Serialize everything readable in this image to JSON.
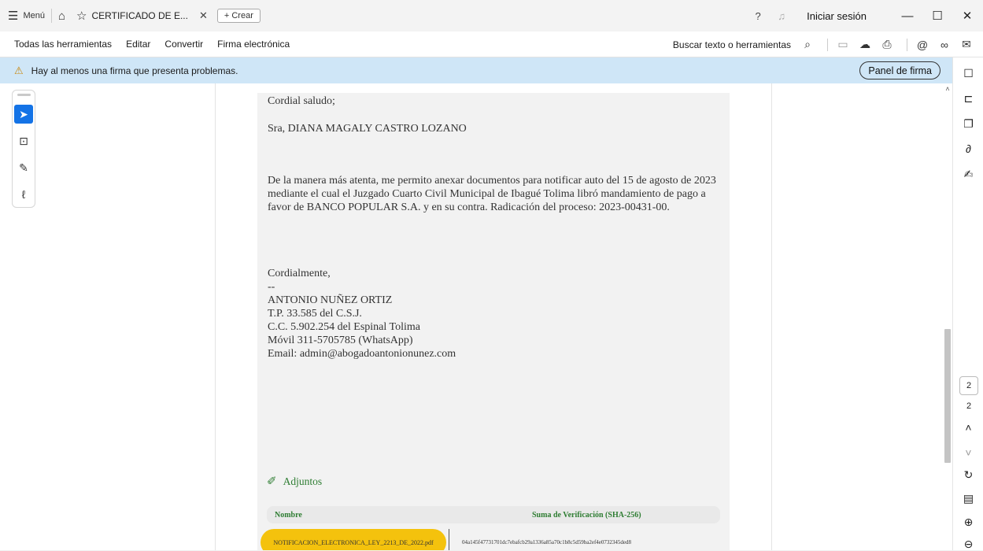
{
  "titlebar": {
    "menu_label": "Menú",
    "tab_title": "CERTIFICADO DE E...",
    "create_label": "+ Crear",
    "signin_label": "Iniciar sesión"
  },
  "toolbar": {
    "items": [
      "Todas las herramientas",
      "Editar",
      "Convertir",
      "Firma electrónica"
    ],
    "search_label": "Buscar texto o herramientas"
  },
  "banner": {
    "message": "Hay al menos una firma que presenta problemas.",
    "panel_button": "Panel de firma"
  },
  "document": {
    "greeting": "Cordial saludo;",
    "recipient": "Sra, DIANA MAGALY CASTRO LOZANO",
    "body": "De la manera más atenta, me permito anexar documentos para notificar auto del 15 de agosto de 2023 mediante el cual el Juzgado Cuarto Civil Municipal de Ibagué Tolima libró mandamiento de pago a favor de BANCO POPULAR S.A. y en su contra. Radicación del proceso: 2023-00431-00.",
    "closing": "Cordialmente,",
    "dashes": "--",
    "signature": [
      "ANTONIO  NUÑEZ ORTIZ",
      "T.P. 33.585 del C.S.J.",
      "C.C. 5.902.254 del Espinal Tolima",
      "Móvil 311-5705785 (WhatsApp)",
      "Email: admin@abogadoantonionunez.com"
    ],
    "attachments_label": "Adjuntos",
    "table_headers": {
      "name": "Nombre",
      "checksum": "Suma de Verificación (SHA-256)"
    },
    "attachment_row": {
      "name": "NOTIFICACION_ELECTRONICA_LEY_2213_DE_2022.pdf",
      "hash": "04a145f47731701dc7ebafcb29a1336a85a70c1b8c5d59ba2ef4e0732345ded8"
    }
  },
  "pagination": {
    "current_page": "2",
    "total_pages": "2"
  },
  "icons": {
    "menu": "hamburger-icon",
    "home": "home-icon",
    "star": "star-icon",
    "help": "help-icon",
    "bell": "bell-icon",
    "search": "search-icon",
    "warning": "signature-warning-icon"
  },
  "colors": {
    "banner_bg": "#cfe6f7",
    "accent": "#1473e6",
    "attachment_green": "#2e7d32",
    "file_pill": "#f4c20d"
  }
}
